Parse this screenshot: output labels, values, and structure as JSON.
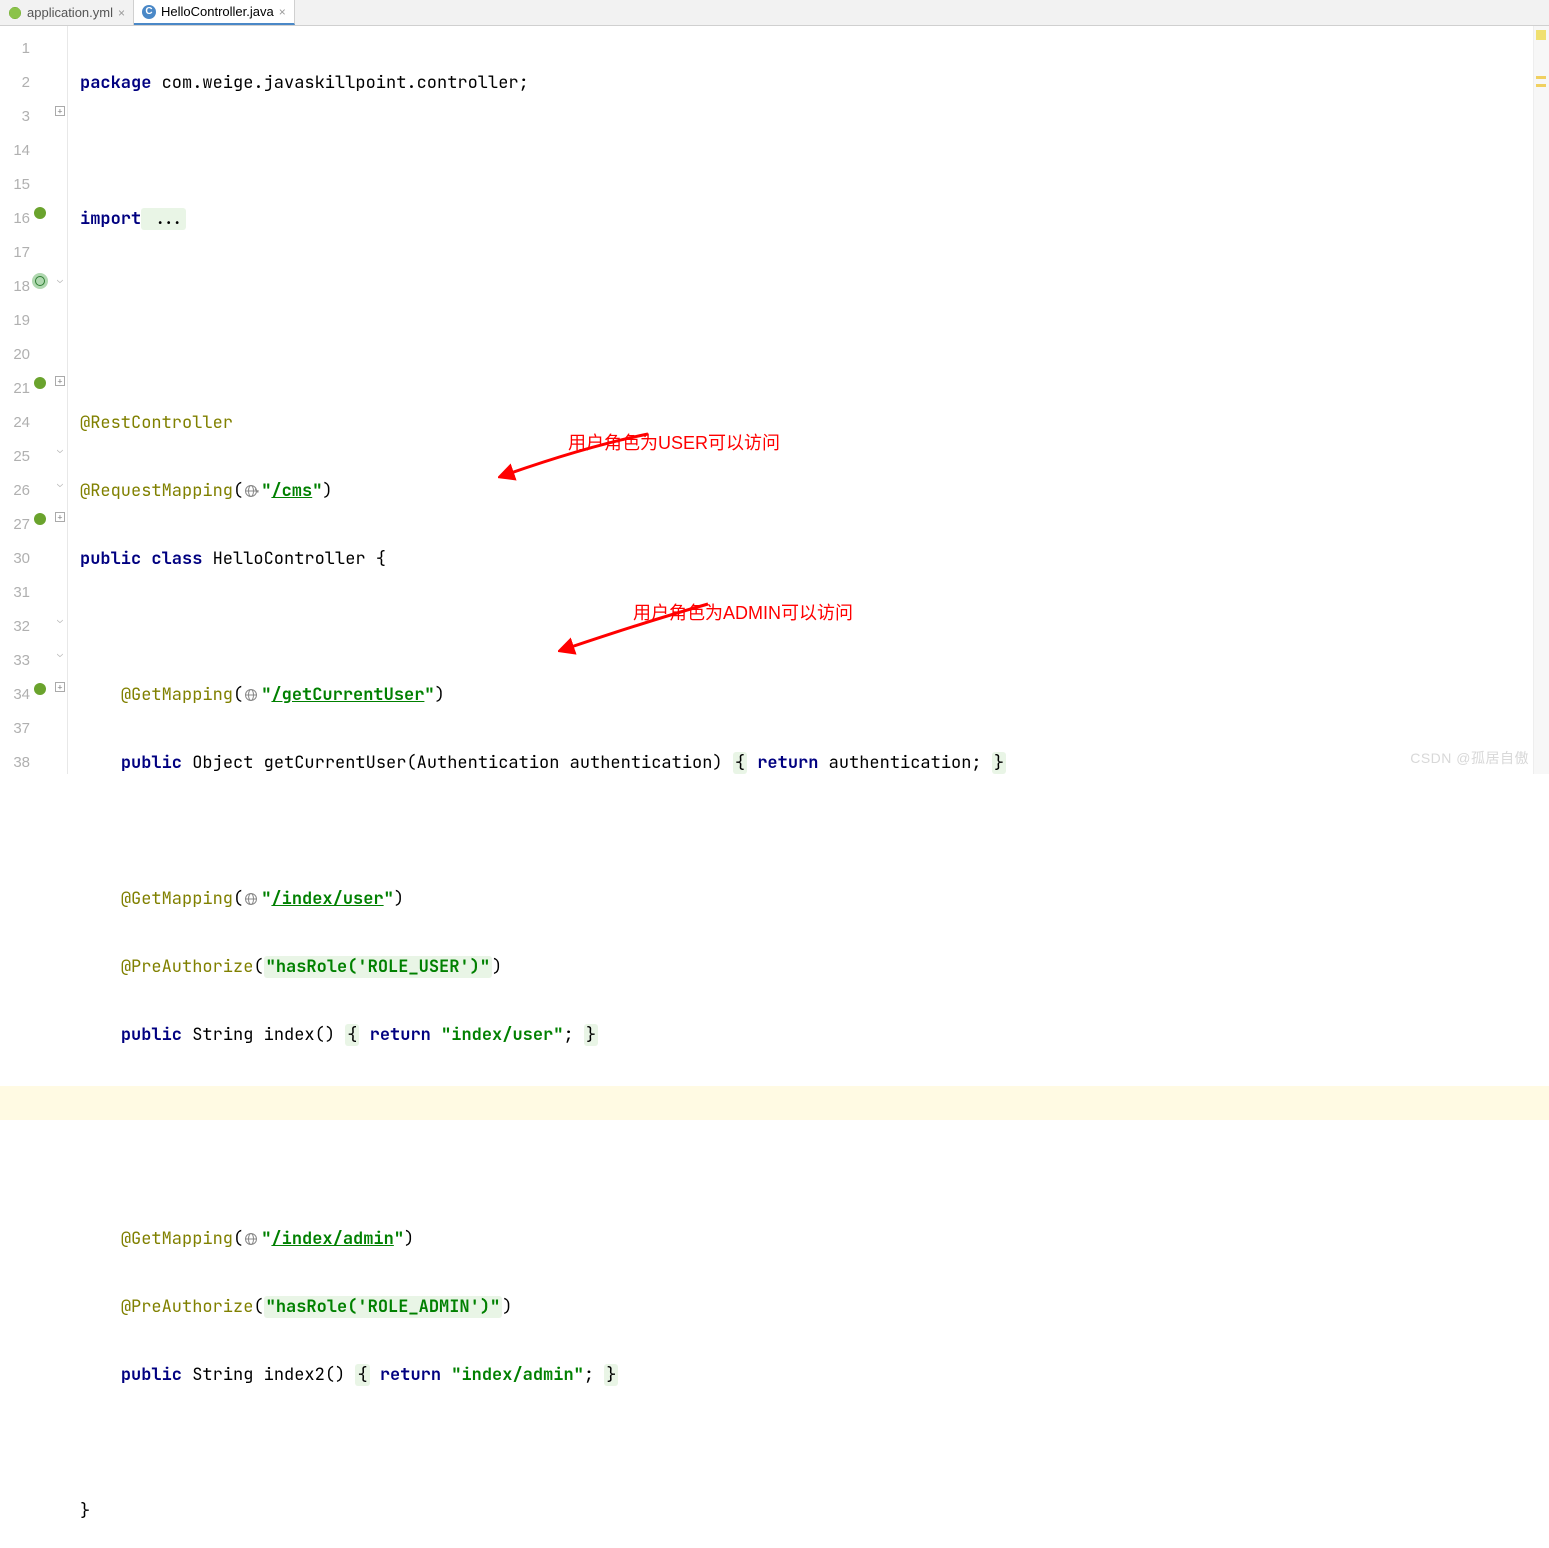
{
  "tabs": [
    {
      "label": "application.yml",
      "icon": "spring",
      "active": false
    },
    {
      "label": "HelloController.java",
      "icon": "class",
      "active": true
    }
  ],
  "gutter_numbers": [
    "1",
    "2",
    "3",
    "14",
    "15",
    "16",
    "17",
    "18",
    "19",
    "20",
    "21",
    "24",
    "25",
    "26",
    "27",
    "30",
    "31",
    "32",
    "33",
    "34",
    "37",
    "38"
  ],
  "code": {
    "l1_kw": "package",
    "l1_rest": " com.weige.javaskillpoint.controller;",
    "l3_kw": "import",
    "l3_rest": " ...",
    "l16": "@RestController",
    "l17_ann": "@RequestMapping",
    "l17_paren_o": "(",
    "l17_str": "\"",
    "l17_path": "/cms",
    "l17_str_end": "\"",
    "l17_paren_c": ")",
    "l18_pub": "public",
    "l18_class": "class",
    "l18_name": " HelloController {",
    "l20_ann": "@GetMapping",
    "l20_str_o": "\"",
    "l20_path": "/getCurrentUser",
    "l20_str_c": "\"",
    "l21_pub": "public",
    "l21_type": " Object ",
    "l21_m": "getCurrentUser(Authentication authentication) ",
    "l21_ret": "return",
    "l21_val": " authentication; ",
    "l25_ann": "@GetMapping",
    "l25_path": "/index/user",
    "l26_ann": "@PreAuthorize",
    "l26_val": "\"hasRole('ROLE_USER')\"",
    "l27_pub": "public",
    "l27_type": " String ",
    "l27_m": "index() ",
    "l27_ret": "return",
    "l27_str": " \"index/user\"",
    "l27_end": "; ",
    "l32_ann": "@GetMapping",
    "l32_path": "/index/admin",
    "l33_ann": "@PreAuthorize",
    "l33_val": "\"hasRole('ROLE_ADMIN')\"",
    "l34_pub": "public",
    "l34_type": " String ",
    "l34_m": "index2() ",
    "l34_ret": "return",
    "l34_str": " \"index/admin\"",
    "l34_end": "; ",
    "l38": "}"
  },
  "annotations": {
    "user_note": "用户角色为USER可以访问",
    "admin_note": "用户角色为ADMIN可以访问"
  },
  "watermark": "CSDN @孤居自傲"
}
